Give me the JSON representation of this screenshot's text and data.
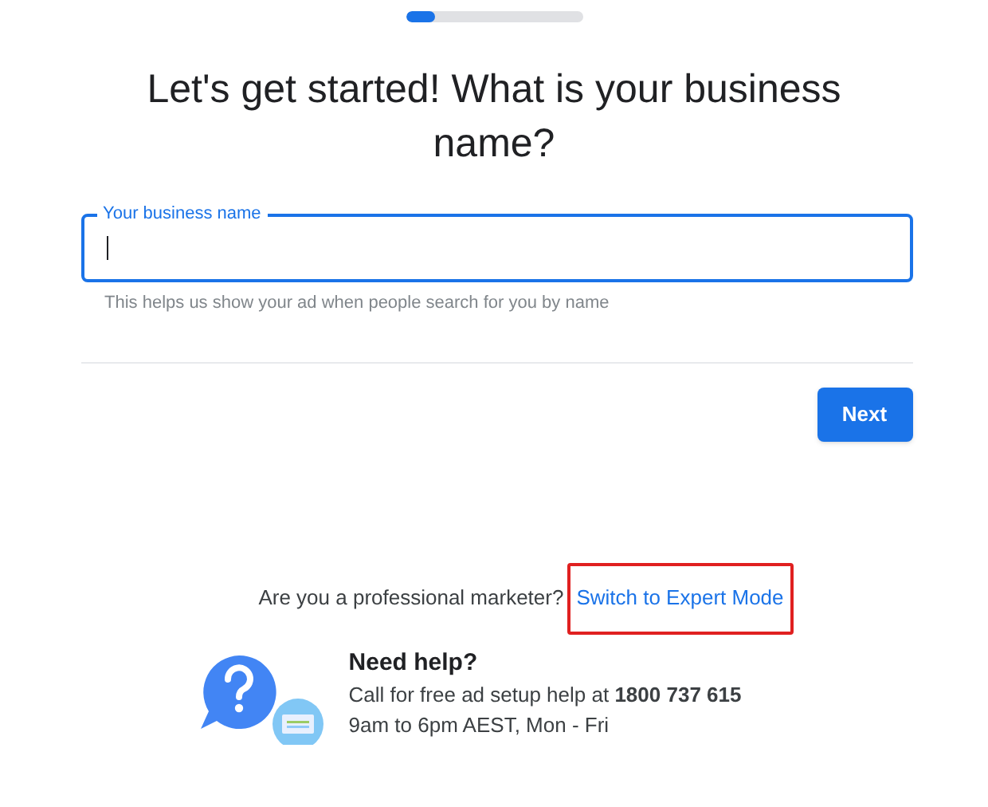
{
  "progress": {
    "level": 0.17
  },
  "title": "Let's get started! What is your business name?",
  "business_name_field": {
    "label": "Your business name",
    "focused": true,
    "helper": "This helps us show your ad when people search for you by name"
  },
  "next_button": "Next",
  "expert_prompt": {
    "question": "Are you a professional marketer?",
    "link": "Switch to Expert Mode",
    "highlighted": true
  },
  "help": {
    "heading": "Need help?",
    "text": "Call for free ad setup help at **1800 737 615**",
    "hours": "9am to 6pm AEST, Mon - Fri"
  }
}
